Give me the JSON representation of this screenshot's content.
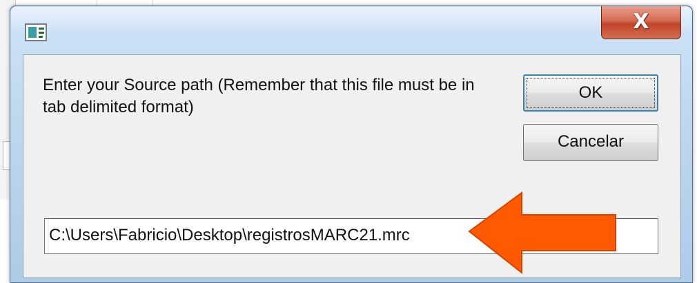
{
  "dialog": {
    "title": "",
    "close_glyph": "X",
    "prompt": "Enter your Source path (Remember that this file must be in tab delimited format)",
    "ok_label": "OK",
    "cancel_label": "Cancelar",
    "path_value": "C:\\Users\\Fabricio\\Desktop\\registrosMARC21.mrc"
  },
  "colors": {
    "arrow": "#ff5a00",
    "close_button": "#c2432a",
    "window_frame": "#bcd6ee"
  },
  "icons": {
    "app": "app-window-icon",
    "close": "close-icon",
    "annotation": "arrow-left-icon"
  }
}
